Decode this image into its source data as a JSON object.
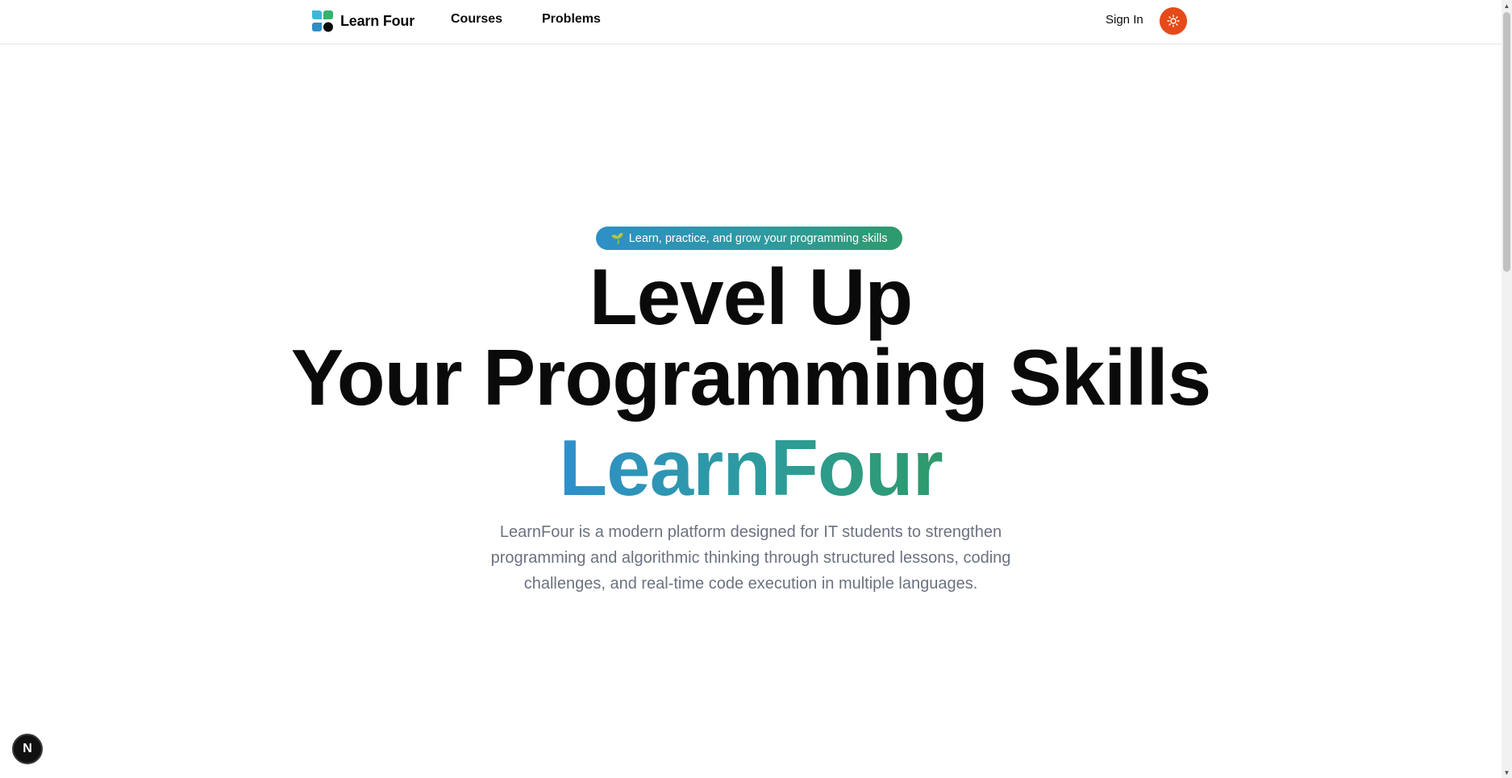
{
  "header": {
    "brand_name": "Learn Four",
    "nav": {
      "courses": "Courses",
      "problems": "Problems"
    },
    "sign_in": "Sign In",
    "theme_toggle_icon": "sun-icon",
    "theme_toggle_color": "#e64a19"
  },
  "hero": {
    "badge_icon": "🌱",
    "badge_text": "Learn, practice, and grow your programming skills",
    "title_line1": "Level Up",
    "title_line2": "Your Programming Skills",
    "brand_highlight": "LearnFour",
    "description": "LearnFour is a modern platform designed for IT students to strengthen programming and algorithmic thinking through structured lessons, coding challenges, and real-time code execution in multiple languages."
  },
  "dev_badge": {
    "label": "N"
  },
  "colors": {
    "gradient_start": "#2f8fcc",
    "gradient_end": "#2e9a6a",
    "text_primary": "#0a0a0a",
    "text_muted": "#6b7280"
  }
}
